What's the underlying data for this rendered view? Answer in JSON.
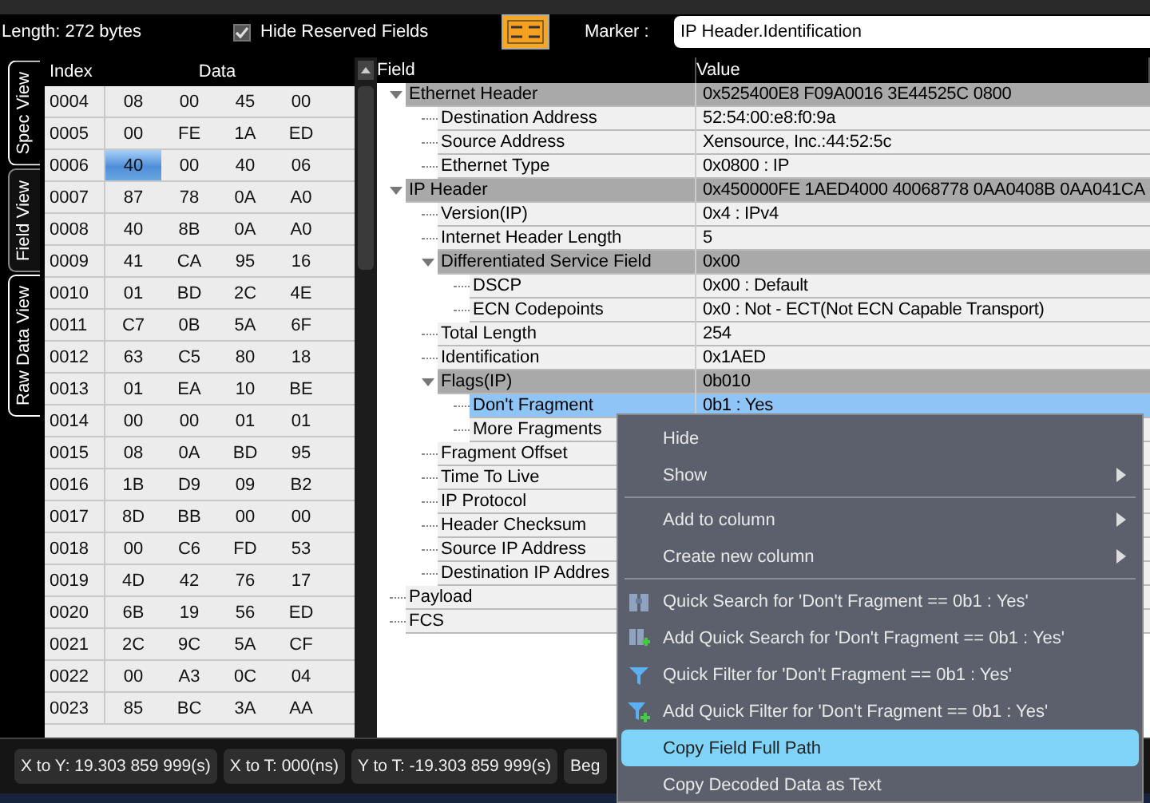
{
  "toolbar": {
    "length": "Length: 272 bytes",
    "hide_reserved": {
      "label": "Hide Reserved Fields",
      "checked": true
    },
    "marker_label": "Marker :",
    "marker_value": "IP Header.Identification"
  },
  "view_tabs": [
    {
      "label": "Spec View",
      "selected": false
    },
    {
      "label": "Field View",
      "selected": true
    },
    {
      "label": "Raw Data View",
      "selected": false
    }
  ],
  "hex_table": {
    "index_header": "Index",
    "data_header": "Data",
    "rows": [
      {
        "index": "0004",
        "cells": [
          {
            "text": "08",
            "selected": false
          },
          {
            "text": "00",
            "selected": false
          },
          {
            "text": "45",
            "selected": false
          },
          {
            "text": "00",
            "selected": false
          }
        ]
      },
      {
        "index": "0005",
        "cells": [
          {
            "text": "00",
            "selected": false
          },
          {
            "text": "FE",
            "selected": false
          },
          {
            "text": "1A",
            "selected": false
          },
          {
            "text": "ED",
            "selected": false
          }
        ]
      },
      {
        "index": "0006",
        "cells": [
          {
            "text": "40",
            "selected": true
          },
          {
            "text": "00",
            "selected": false
          },
          {
            "text": "40",
            "selected": false
          },
          {
            "text": "06",
            "selected": false
          }
        ]
      },
      {
        "index": "0007",
        "cells": [
          {
            "text": "87",
            "selected": false
          },
          {
            "text": "78",
            "selected": false
          },
          {
            "text": "0A",
            "selected": false
          },
          {
            "text": "A0",
            "selected": false
          }
        ]
      },
      {
        "index": "0008",
        "cells": [
          {
            "text": "40",
            "selected": false
          },
          {
            "text": "8B",
            "selected": false
          },
          {
            "text": "0A",
            "selected": false
          },
          {
            "text": "A0",
            "selected": false
          }
        ]
      },
      {
        "index": "0009",
        "cells": [
          {
            "text": "41",
            "selected": false
          },
          {
            "text": "CA",
            "selected": false
          },
          {
            "text": "95",
            "selected": false
          },
          {
            "text": "16",
            "selected": false
          }
        ]
      },
      {
        "index": "0010",
        "cells": [
          {
            "text": "01",
            "selected": false
          },
          {
            "text": "BD",
            "selected": false
          },
          {
            "text": "2C",
            "selected": false
          },
          {
            "text": "4E",
            "selected": false
          }
        ]
      },
      {
        "index": "0011",
        "cells": [
          {
            "text": "C7",
            "selected": false
          },
          {
            "text": "0B",
            "selected": false
          },
          {
            "text": "5A",
            "selected": false
          },
          {
            "text": "6F",
            "selected": false
          }
        ]
      },
      {
        "index": "0012",
        "cells": [
          {
            "text": "63",
            "selected": false
          },
          {
            "text": "C5",
            "selected": false
          },
          {
            "text": "80",
            "selected": false
          },
          {
            "text": "18",
            "selected": false
          }
        ]
      },
      {
        "index": "0013",
        "cells": [
          {
            "text": "01",
            "selected": false
          },
          {
            "text": "EA",
            "selected": false
          },
          {
            "text": "10",
            "selected": false
          },
          {
            "text": "BE",
            "selected": false
          }
        ]
      },
      {
        "index": "0014",
        "cells": [
          {
            "text": "00",
            "selected": false
          },
          {
            "text": "00",
            "selected": false
          },
          {
            "text": "01",
            "selected": false
          },
          {
            "text": "01",
            "selected": false
          }
        ]
      },
      {
        "index": "0015",
        "cells": [
          {
            "text": "08",
            "selected": false
          },
          {
            "text": "0A",
            "selected": false
          },
          {
            "text": "BD",
            "selected": false
          },
          {
            "text": "95",
            "selected": false
          }
        ]
      },
      {
        "index": "0016",
        "cells": [
          {
            "text": "1B",
            "selected": false
          },
          {
            "text": "D9",
            "selected": false
          },
          {
            "text": "09",
            "selected": false
          },
          {
            "text": "B2",
            "selected": false
          }
        ]
      },
      {
        "index": "0017",
        "cells": [
          {
            "text": "8D",
            "selected": false
          },
          {
            "text": "BB",
            "selected": false
          },
          {
            "text": "00",
            "selected": false
          },
          {
            "text": "00",
            "selected": false
          }
        ]
      },
      {
        "index": "0018",
        "cells": [
          {
            "text": "00",
            "selected": false
          },
          {
            "text": "C6",
            "selected": false
          },
          {
            "text": "FD",
            "selected": false
          },
          {
            "text": "53",
            "selected": false
          }
        ]
      },
      {
        "index": "0019",
        "cells": [
          {
            "text": "4D",
            "selected": false
          },
          {
            "text": "42",
            "selected": false
          },
          {
            "text": "76",
            "selected": false
          },
          {
            "text": "17",
            "selected": false
          }
        ]
      },
      {
        "index": "0020",
        "cells": [
          {
            "text": "6B",
            "selected": false
          },
          {
            "text": "19",
            "selected": false
          },
          {
            "text": "56",
            "selected": false
          },
          {
            "text": "ED",
            "selected": false
          }
        ]
      },
      {
        "index": "0021",
        "cells": [
          {
            "text": "2C",
            "selected": false
          },
          {
            "text": "9C",
            "selected": false
          },
          {
            "text": "5A",
            "selected": false
          },
          {
            "text": "CF",
            "selected": false
          }
        ]
      },
      {
        "index": "0022",
        "cells": [
          {
            "text": "00",
            "selected": false
          },
          {
            "text": "A3",
            "selected": false
          },
          {
            "text": "0C",
            "selected": false
          },
          {
            "text": "04",
            "selected": false
          }
        ]
      },
      {
        "index": "0023",
        "cells": [
          {
            "text": "85",
            "selected": false
          },
          {
            "text": "BC",
            "selected": false
          },
          {
            "text": "3A",
            "selected": false
          },
          {
            "text": "AA",
            "selected": false
          }
        ]
      }
    ]
  },
  "field_tree": {
    "columns": [
      "Field",
      "Value"
    ],
    "rows": [
      {
        "field": "Ethernet Header",
        "value": "0x525400E8 F09A0016 3E44525C 0800",
        "selected": false,
        "expanded": true,
        "children": [
          {
            "field": "Destination Address",
            "value": "52:54:00:e8:f0:9a",
            "selected": false
          },
          {
            "field": "Source Address",
            "value": "Xensource, Inc.:44:52:5c",
            "selected": false
          },
          {
            "field": "Ethernet Type",
            "value": "0x0800 : IP",
            "selected": false
          }
        ]
      },
      {
        "field": "IP Header",
        "value": "0x450000FE 1AED4000 40068778 0AA0408B 0AA041CA",
        "selected": false,
        "expanded": true,
        "children": [
          {
            "field": "Version(IP)",
            "value": "0x4 : IPv4",
            "selected": false
          },
          {
            "field": "Internet Header Length",
            "value": "5",
            "selected": false
          },
          {
            "field": "Differentiated Service Field",
            "value": "0x00",
            "selected": false,
            "expanded": true,
            "children": [
              {
                "field": "DSCP",
                "value": "0x00 : Default",
                "selected": false
              },
              {
                "field": "ECN Codepoints",
                "value": "0x0 : Not - ECT(Not ECN Capable Transport)",
                "selected": false
              }
            ]
          },
          {
            "field": "Total Length",
            "value": "254",
            "selected": false
          },
          {
            "field": "Identification",
            "value": "0x1AED",
            "selected": false
          },
          {
            "field": "Flags(IP)",
            "value": "0b010",
            "selected": false,
            "expanded": true,
            "children": [
              {
                "field": "Don't Fragment",
                "value": "0b1 : Yes",
                "selected": true
              },
              {
                "field": "More Fragments",
                "selected": false
              }
            ]
          },
          {
            "field": "Fragment Offset",
            "selected": false
          },
          {
            "field": "Time To Live",
            "selected": false
          },
          {
            "field": "IP Protocol",
            "selected": false
          },
          {
            "field": "Header Checksum",
            "selected": false
          },
          {
            "field": "Source IP Address",
            "selected": false
          },
          {
            "field": "Destination IP Addres",
            "selected": false
          }
        ]
      },
      {
        "field": "Payload",
        "selected": false
      },
      {
        "field": "FCS",
        "selected": false
      }
    ]
  },
  "context_menu": [
    {
      "kind": "item",
      "label": "Hide",
      "submenu": false,
      "selected": false
    },
    {
      "kind": "item",
      "label": "Show",
      "submenu": true,
      "selected": false
    },
    {
      "kind": "separator"
    },
    {
      "kind": "item",
      "label": "Add to column",
      "submenu": true,
      "selected": false
    },
    {
      "kind": "item",
      "label": "Create new column",
      "submenu": true,
      "selected": false
    },
    {
      "kind": "separator"
    },
    {
      "kind": "search",
      "label": "Quick Search for 'Don't Fragment == 0b1 : Yes'",
      "submenu": false,
      "selected": false
    },
    {
      "kind": "search-add",
      "label": "Add Quick Search for 'Don't Fragment == 0b1 : Yes'",
      "submenu": false,
      "selected": false
    },
    {
      "kind": "filter",
      "label": "Quick Filter for 'Don't Fragment == 0b1 : Yes'",
      "submenu": false,
      "selected": false
    },
    {
      "kind": "filter-add",
      "label": "Add Quick Filter for 'Don't Fragment == 0b1 : Yes'",
      "submenu": false,
      "selected": false
    },
    {
      "kind": "item",
      "label": "Copy Field Full Path",
      "submenu": false,
      "selected": true
    },
    {
      "kind": "item",
      "label": "Copy Decoded Data as Text",
      "submenu": false,
      "selected": false
    }
  ],
  "status_bar": [
    "X to Y: 19.303 859 999(s)",
    "X to T: 000(ns)",
    "Y to T: -19.303 859 999(s)",
    "Beg"
  ]
}
